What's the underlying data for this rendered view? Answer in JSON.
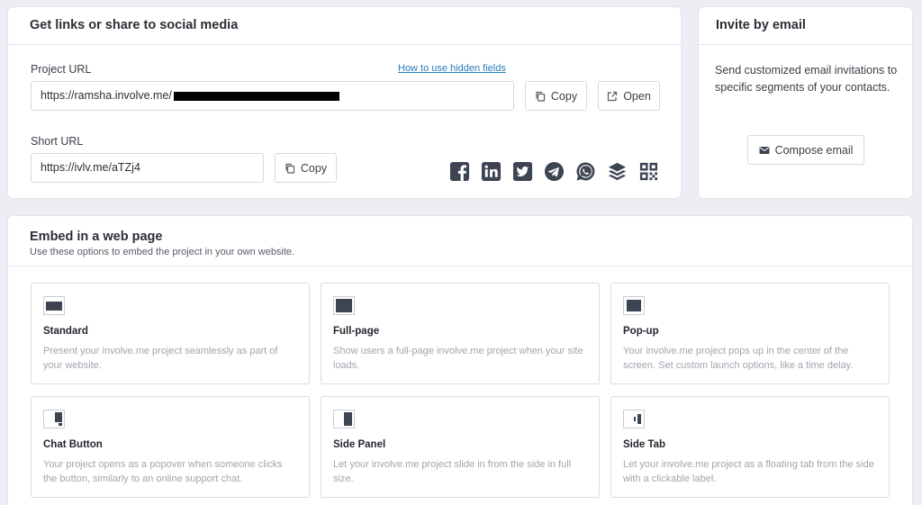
{
  "share": {
    "title": "Get links or share to social media",
    "project_url_label": "Project URL",
    "hidden_fields_link": "How to use hidden fields",
    "project_url_value": "https://ramsha.involve.me/",
    "copy_label": "Copy",
    "open_label": "Open",
    "short_url_label": "Short URL",
    "short_url_value": "https://ivlv.me/aTZj4",
    "social_icons": [
      "facebook-icon",
      "linkedin-icon",
      "twitter-icon",
      "telegram-icon",
      "whatsapp-icon",
      "buffer-icon",
      "qr-code-icon"
    ]
  },
  "invite": {
    "title": "Invite by email",
    "text": "Send customized email invitations to specific segments of your contacts.",
    "compose_label": "Compose email"
  },
  "embed": {
    "title": "Embed in a web page",
    "subtitle": "Use these options to embed the project in your own website.",
    "options": [
      {
        "title": "Standard",
        "desc": "Present your involve.me project seamlessly as part of your website."
      },
      {
        "title": "Full-page",
        "desc": "Show users a full-page involve.me project when your site loads."
      },
      {
        "title": "Pop-up",
        "desc": "Your involve.me project pops up in the center of the screen. Set custom launch options, like a time delay."
      },
      {
        "title": "Chat Button",
        "desc": "Your project opens as a popover when someone clicks the button, similarly to an online support chat."
      },
      {
        "title": "Side Panel",
        "desc": "Let your involve.me project slide in from the side in full size."
      },
      {
        "title": "Side Tab",
        "desc": "Let your involve.me project as a floating tab from the side with a clickable label."
      }
    ]
  },
  "colors": {
    "icon_dark": "#3d4552",
    "link": "#2a7dbb",
    "background": "#eceef4"
  }
}
